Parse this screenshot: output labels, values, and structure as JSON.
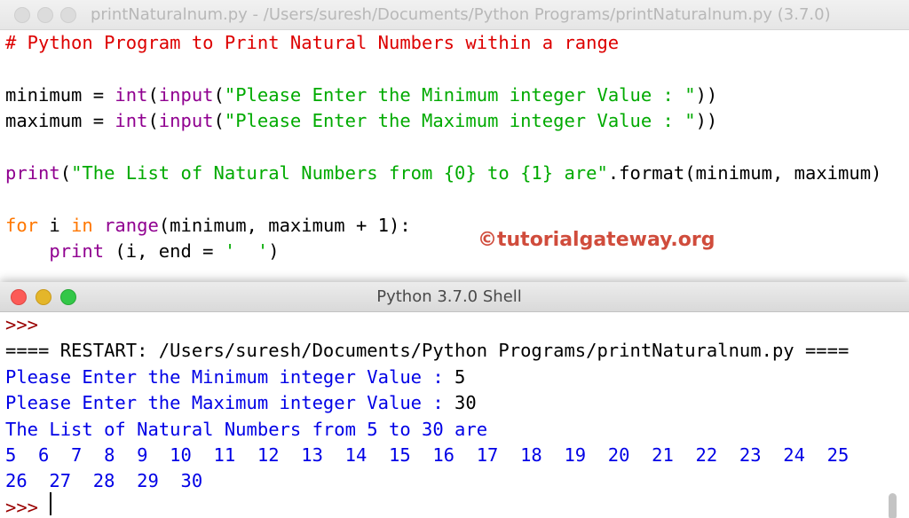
{
  "editor": {
    "title": "printNaturalnum.py - /Users/suresh/Documents/Python Programs/printNaturalnum.py (3.7.0)",
    "lines": [
      [
        {
          "t": "comment",
          "s": "# Python Program to Print Natural Numbers within a range"
        }
      ],
      [],
      [
        {
          "t": "plain",
          "s": "minimum = "
        },
        {
          "t": "builtin",
          "s": "int"
        },
        {
          "t": "plain",
          "s": "("
        },
        {
          "t": "builtin",
          "s": "input"
        },
        {
          "t": "plain",
          "s": "("
        },
        {
          "t": "string",
          "s": "\"Please Enter the Minimum integer Value : \""
        },
        {
          "t": "plain",
          "s": "))"
        }
      ],
      [
        {
          "t": "plain",
          "s": "maximum = "
        },
        {
          "t": "builtin",
          "s": "int"
        },
        {
          "t": "plain",
          "s": "("
        },
        {
          "t": "builtin",
          "s": "input"
        },
        {
          "t": "plain",
          "s": "("
        },
        {
          "t": "string",
          "s": "\"Please Enter the Maximum integer Value : \""
        },
        {
          "t": "plain",
          "s": "))"
        }
      ],
      [],
      [
        {
          "t": "builtin",
          "s": "print"
        },
        {
          "t": "plain",
          "s": "("
        },
        {
          "t": "string",
          "s": "\"The List of Natural Numbers from {0} to {1} are\""
        },
        {
          "t": "plain",
          "s": ".format(minimum, maximum)"
        }
      ],
      [],
      [
        {
          "t": "keyword",
          "s": "for"
        },
        {
          "t": "plain",
          "s": " i "
        },
        {
          "t": "keyword",
          "s": "in"
        },
        {
          "t": "plain",
          "s": " "
        },
        {
          "t": "builtin",
          "s": "range"
        },
        {
          "t": "plain",
          "s": "(minimum, maximum + 1):"
        }
      ],
      [
        {
          "t": "plain",
          "s": "    "
        },
        {
          "t": "builtin",
          "s": "print"
        },
        {
          "t": "plain",
          "s": " (i, end = "
        },
        {
          "t": "string",
          "s": "'  '"
        },
        {
          "t": "plain",
          "s": ")"
        }
      ]
    ]
  },
  "watermark": "©tutorialgateway.org",
  "shell": {
    "title": "Python 3.7.0 Shell",
    "lines": [
      {
        "cls": "prompt",
        "s": ">>>"
      },
      {
        "cls": "black",
        "s": "==== RESTART: /Users/suresh/Documents/Python Programs/printNaturalnum.py ===="
      },
      {
        "cls": "blue",
        "s": "Please Enter the Minimum integer Value : ",
        "input": "5"
      },
      {
        "cls": "blue",
        "s": "Please Enter the Maximum integer Value : ",
        "input": "30"
      },
      {
        "cls": "blue",
        "s": "The List of Natural Numbers from 5 to 30 are"
      },
      {
        "cls": "blue",
        "s": "5  6  7  8  9  10  11  12  13  14  15  16  17  18  19  20  21  22  23  24  25"
      },
      {
        "cls": "blue",
        "s": "26  27  28  29  30"
      },
      {
        "cls": "prompt",
        "s": ">>> "
      }
    ]
  },
  "colors": {
    "comment": "#dd0000",
    "builtin": "#900090",
    "keyword": "#ff7700",
    "string": "#00aa00",
    "shell_output": "#0000e6",
    "shell_prompt": "#990000",
    "watermark": "#d04c3c"
  }
}
